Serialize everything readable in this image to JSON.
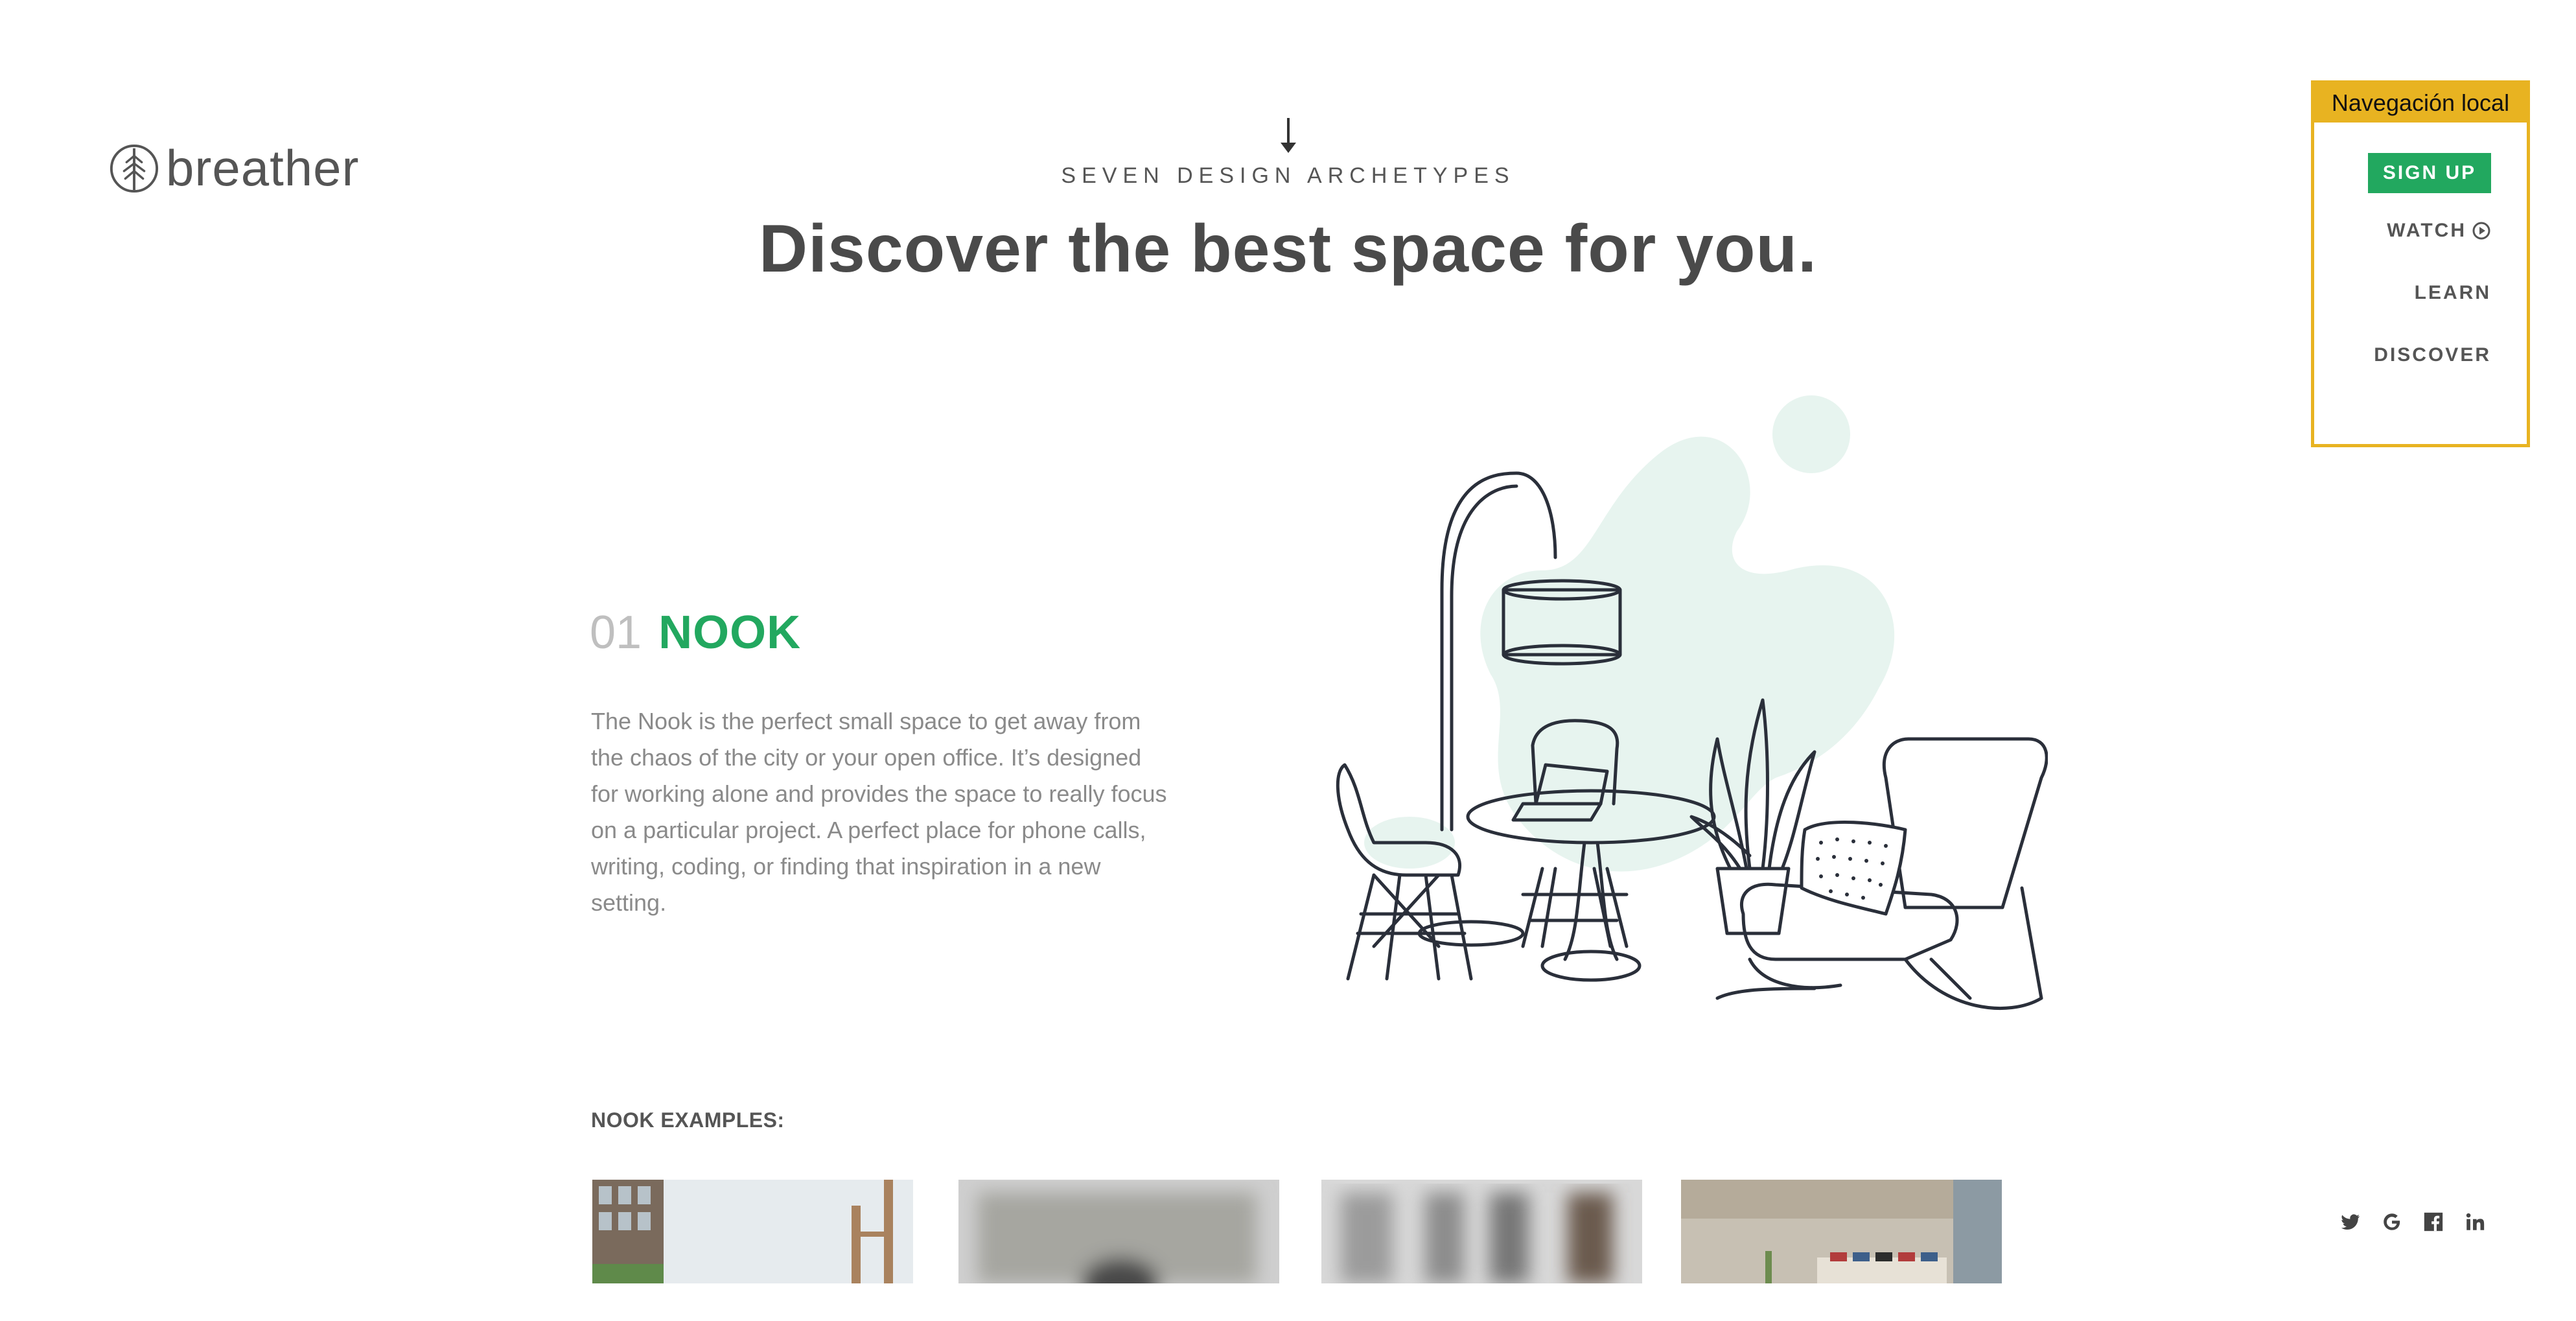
{
  "logo": {
    "text": "breather"
  },
  "hero": {
    "eyebrow": "SEVEN DESIGN ARCHETYPES",
    "title": "Discover the best space for you."
  },
  "local_nav": {
    "header": "Navegación local",
    "signup": "SIGN UP",
    "watch": "WATCH",
    "learn": "LEARN",
    "discover": "DISCOVER"
  },
  "nook": {
    "number": "01",
    "title": "NOOK",
    "description": "The Nook is the perfect small space to get away from the chaos of the city or your open office. It’s designed for working alone and provides the space to really focus on a particular project. A perfect place for phone calls, writing, coding, or finding that inspiration in a new setting.",
    "examples_label": "NOOK EXAMPLES:"
  },
  "social": {
    "icons": [
      "twitter-icon",
      "google-icon",
      "facebook-icon",
      "linkedin-icon"
    ]
  },
  "colors": {
    "accent_green": "#22a85f",
    "nav_highlight": "#e8b321",
    "blob": "#e7f4ef"
  }
}
